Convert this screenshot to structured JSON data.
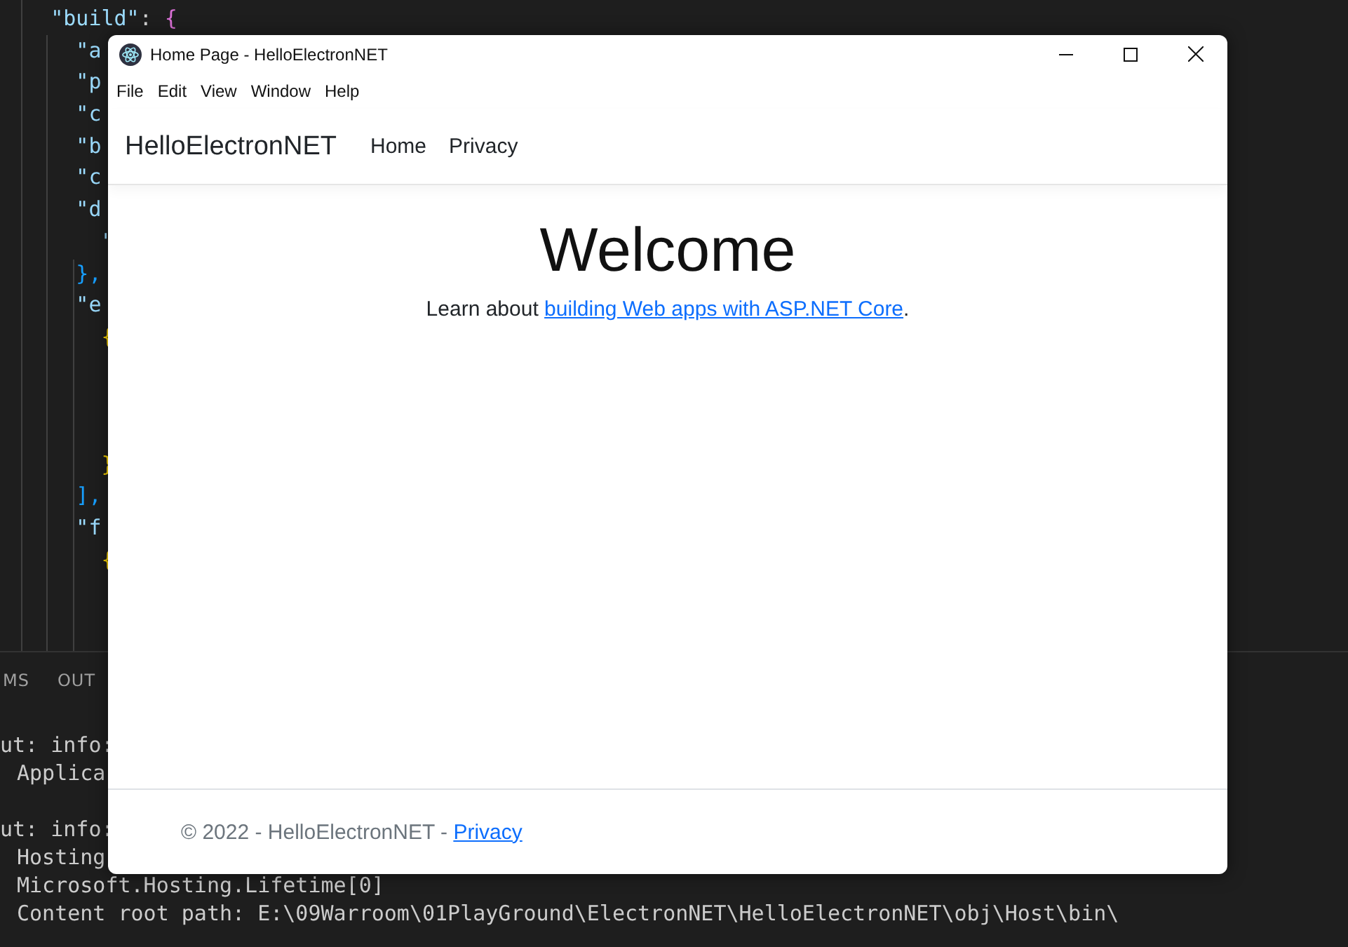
{
  "editor": {
    "lines": [
      {
        "kind": "code",
        "tokens": [
          {
            "text": "    \"build\"",
            "kind": "key"
          },
          {
            "text": ": ",
            "kind": "punct"
          },
          {
            "text": "{",
            "kind": "brace1"
          }
        ]
      },
      {
        "kind": "code",
        "tokens": [
          {
            "text": "      \"a",
            "kind": "key"
          }
        ]
      },
      {
        "kind": "code",
        "tokens": [
          {
            "text": "      \"p",
            "kind": "key"
          }
        ]
      },
      {
        "kind": "code",
        "tokens": [
          {
            "text": "      \"c",
            "kind": "key"
          }
        ]
      },
      {
        "kind": "code",
        "tokens": [
          {
            "text": "      \"b",
            "kind": "key"
          }
        ]
      },
      {
        "kind": "code",
        "tokens": [
          {
            "text": "      \"c",
            "kind": "key"
          }
        ]
      },
      {
        "kind": "code",
        "tokens": [
          {
            "text": "      \"d",
            "kind": "key"
          }
        ]
      },
      {
        "kind": "code",
        "tokens": [
          {
            "text": "        \"",
            "kind": "key"
          }
        ]
      },
      {
        "kind": "code",
        "tokens": [
          {
            "text": "      },",
            "kind": "brace2"
          }
        ]
      },
      {
        "kind": "code",
        "tokens": [
          {
            "text": "      \"e",
            "kind": "key"
          }
        ]
      },
      {
        "kind": "code",
        "tokens": [
          {
            "text": "        {",
            "kind": "brace3"
          }
        ]
      },
      {
        "kind": "blank"
      },
      {
        "kind": "blank"
      },
      {
        "kind": "blank"
      },
      {
        "kind": "code",
        "tokens": [
          {
            "text": "        }",
            "kind": "brace3"
          }
        ]
      },
      {
        "kind": "code",
        "tokens": [
          {
            "text": "      ],",
            "kind": "brace2"
          }
        ]
      },
      {
        "kind": "code",
        "tokens": [
          {
            "text": "      \"f",
            "kind": "key"
          }
        ]
      },
      {
        "kind": "code",
        "tokens": [
          {
            "text": "        {",
            "kind": "brace3"
          }
        ]
      }
    ]
  },
  "panel": {
    "tabs": [
      "MS",
      "OUT"
    ],
    "lines": [
      {
        "text": "ut: info:",
        "kind": "header"
      },
      {
        "text": "Applica",
        "kind": "detail"
      },
      {
        "kind": "blank"
      },
      {
        "text": "ut: info:",
        "kind": "header"
      },
      {
        "text": "Hosting",
        "kind": "detail"
      },
      {
        "text": "Microsoft.Hosting.Lifetime[0]",
        "kind": "detail"
      },
      {
        "text": "Content root path: E:\\09Warroom\\01PlayGround\\ElectronNET\\HelloElectronNET\\obj\\Host\\bin\\",
        "kind": "detail"
      }
    ]
  },
  "window": {
    "title": "Home Page - HelloElectronNET",
    "menu": [
      "File",
      "Edit",
      "View",
      "Window",
      "Help"
    ],
    "navbar": {
      "brand": "HelloElectronNET",
      "links": [
        "Home",
        "Privacy"
      ]
    },
    "heading": "Welcome",
    "lead": {
      "before": "Learn about ",
      "link": "building Web apps with ASP.NET Core",
      "after": "."
    },
    "footer": {
      "text": "© 2022 - HelloElectronNET - ",
      "link": "Privacy"
    }
  }
}
